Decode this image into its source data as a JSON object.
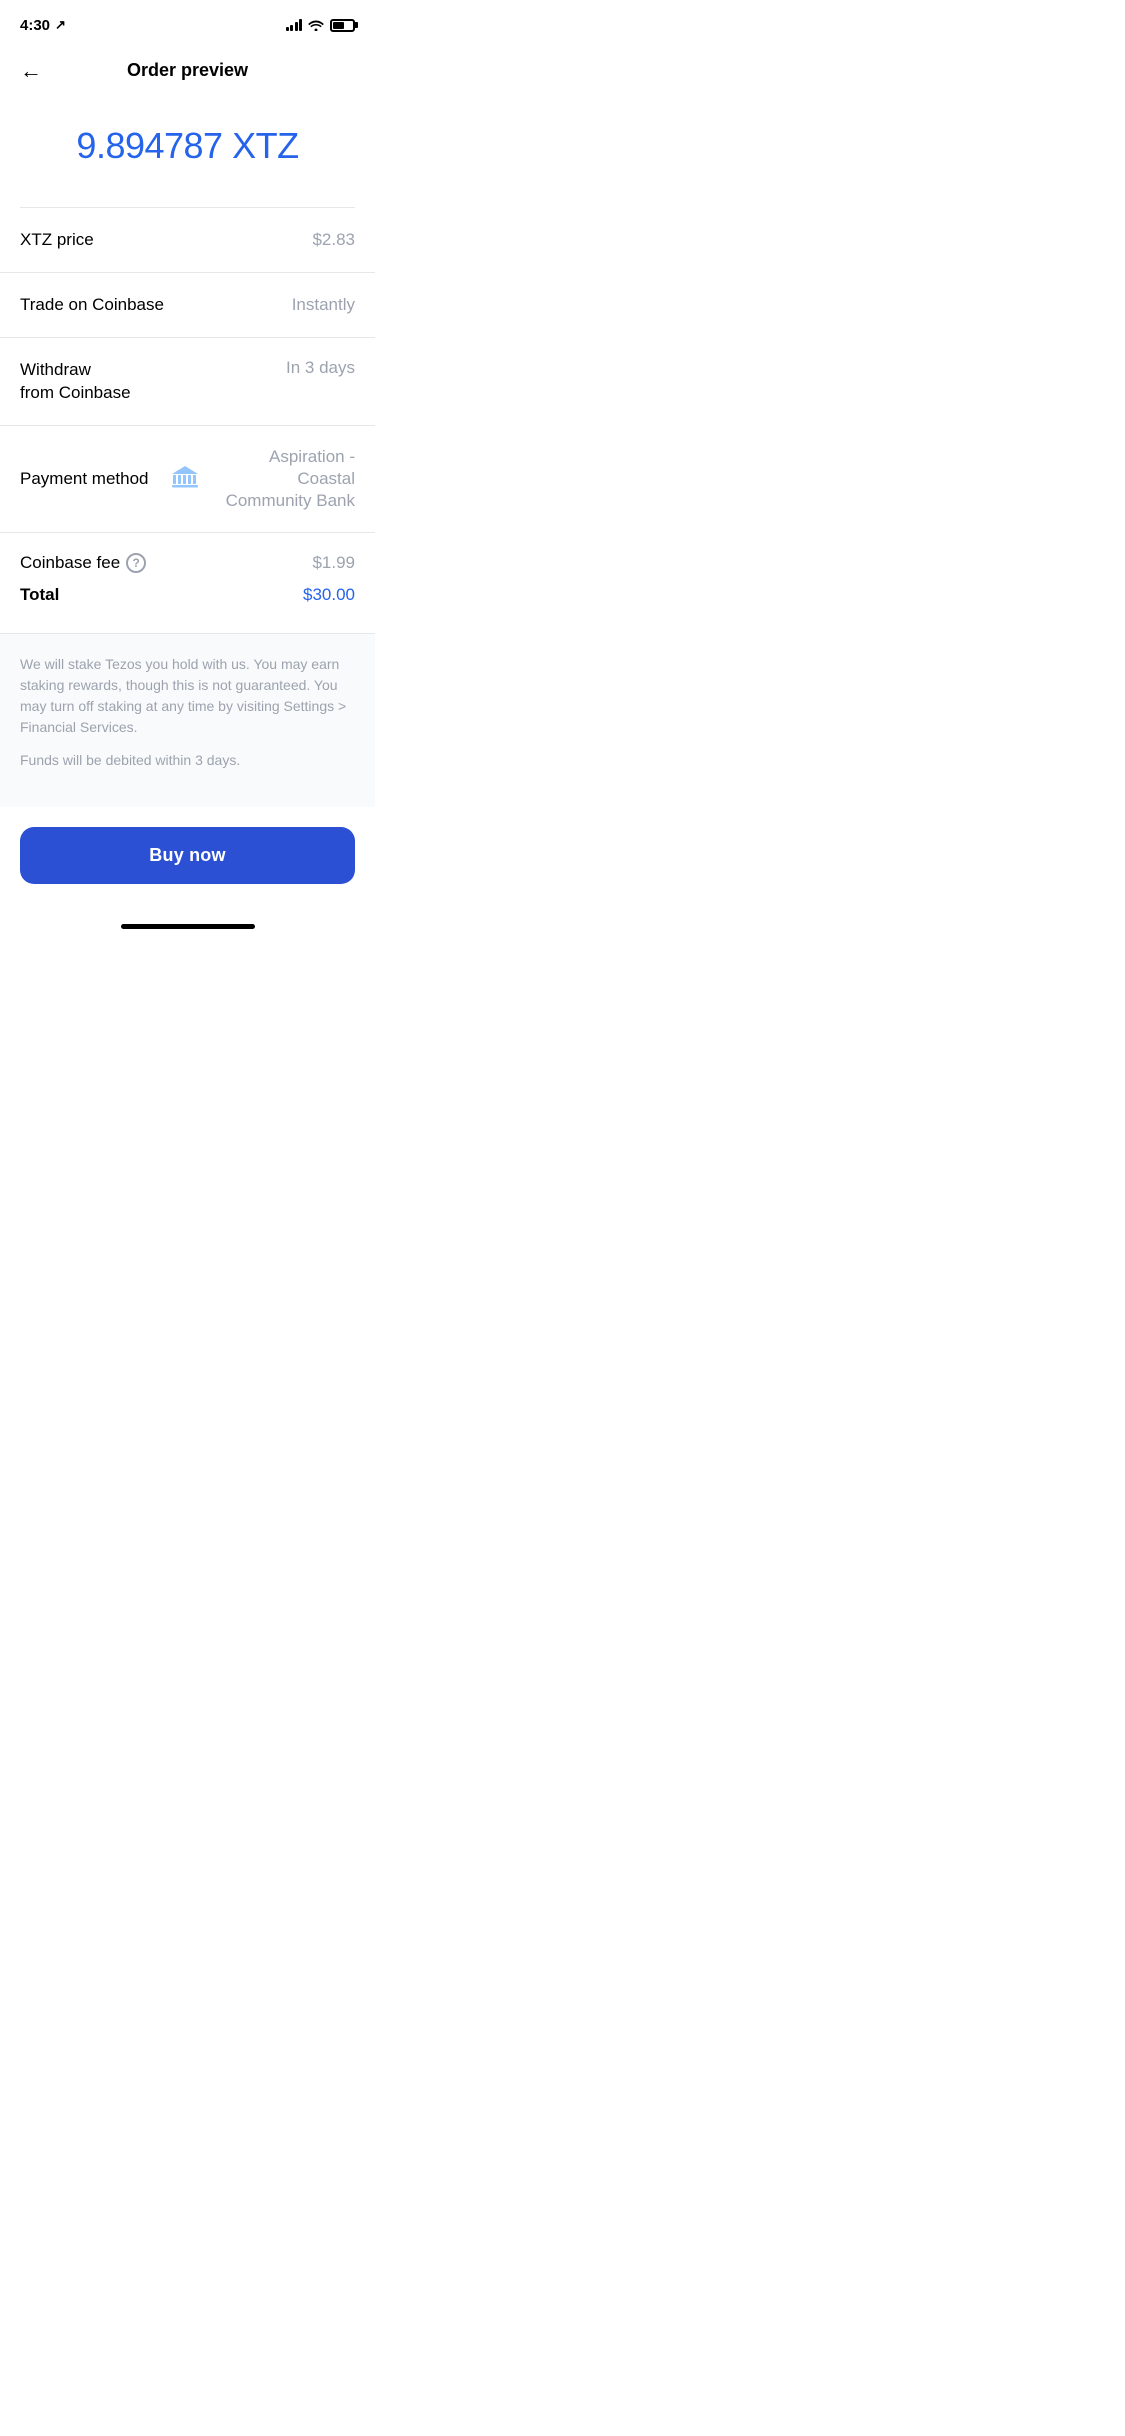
{
  "statusBar": {
    "time": "4:30",
    "locationIcon": "⤢"
  },
  "header": {
    "backLabel": "←",
    "title": "Order preview"
  },
  "amount": {
    "value": "9.894787 XTZ",
    "color": "#2563EB"
  },
  "rows": [
    {
      "label": "XTZ price",
      "value": "$2.83",
      "type": "simple"
    },
    {
      "label": "Trade on Coinbase",
      "value": "Instantly",
      "type": "simple"
    },
    {
      "label": "Withdraw\nfrom Coinbase",
      "value": "In 3 days",
      "type": "multiline"
    }
  ],
  "paymentMethod": {
    "label": "Payment method",
    "bankName": "Aspiration - Coastal Community Bank"
  },
  "fees": {
    "feeLabel": "Coinbase fee",
    "feeValue": "$1.99",
    "totalLabel": "Total",
    "totalValue": "$30.00"
  },
  "disclaimer": {
    "staking": "We will stake Tezos you hold with us. You may earn staking rewards, though this is not guaranteed. You may turn off staking at any time by visiting Settings > Financial Services.",
    "funds": "Funds will be debited within 3 days."
  },
  "buyButton": {
    "label": "Buy now"
  }
}
